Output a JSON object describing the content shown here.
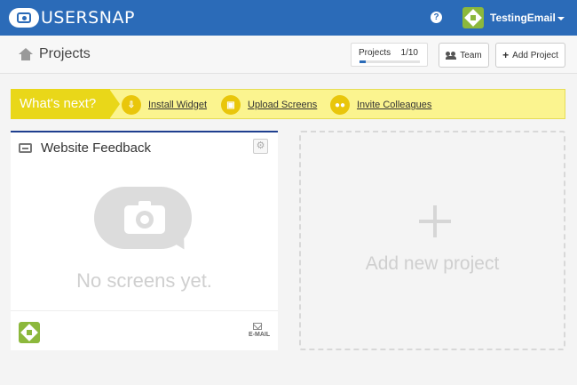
{
  "brand": {
    "name": "USERSNAP"
  },
  "topbar": {
    "help_icon": "question-circle-icon",
    "user_name": "TestingEmail",
    "accent": "#2b6bb8"
  },
  "header": {
    "title": "Projects",
    "home_icon": "home-icon"
  },
  "projects_meter": {
    "label": "Projects",
    "count": "1/10",
    "used_fraction": 0.1
  },
  "toolbar": {
    "team_label": "Team",
    "add_project_label": "Add Project"
  },
  "whats_next": {
    "label": "What's next?",
    "steps": [
      {
        "label": "Install Widget",
        "icon": "download-icon"
      },
      {
        "label": "Upload Screens",
        "icon": "image-icon"
      },
      {
        "label": "Invite Colleagues",
        "icon": "users-icon"
      }
    ]
  },
  "project_card": {
    "title": "Website Feedback",
    "empty_text": "No screens yet.",
    "email_label": "E-MAIL"
  },
  "add_project_card": {
    "label": "Add new project"
  }
}
